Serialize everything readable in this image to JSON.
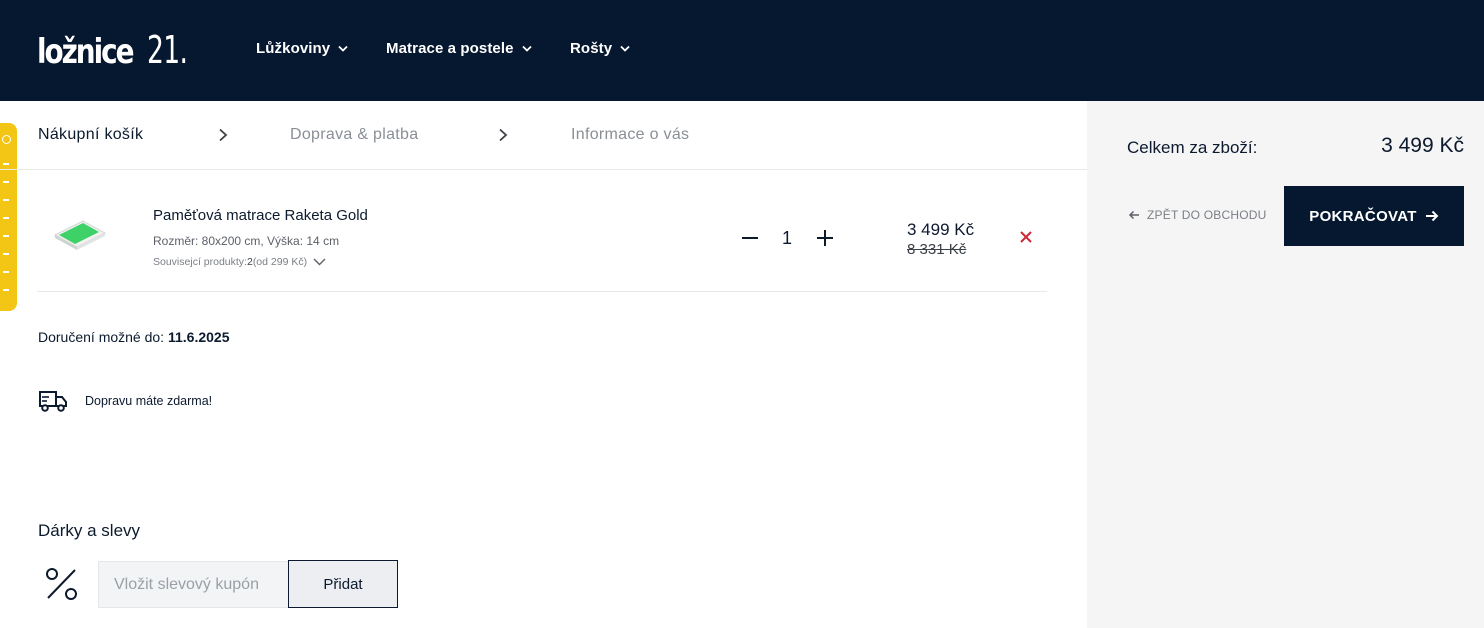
{
  "header": {
    "logo_word": "ložnice",
    "logo_num": "21.",
    "nav": [
      {
        "label": "Lůžkoviny"
      },
      {
        "label": "Matrace a postele"
      },
      {
        "label": "Rošty"
      }
    ]
  },
  "steps": [
    {
      "label": "Nákupní košík"
    },
    {
      "label": "Doprava & platba"
    },
    {
      "label": "Informace o vás"
    }
  ],
  "cart": {
    "item": {
      "name": "Paměťová matrace Raketa Gold",
      "meta": "Rozměr: 80x200 cm, Výška: 14 cm",
      "related_prefix": "Souvisejcí produkty: ",
      "related_count": "2",
      "related_suffix": " (od 299 Kč)",
      "quantity": "1",
      "price": "3 499 Kč",
      "old_price": "8 331 Kč"
    }
  },
  "delivery": {
    "prefix": "Doručení možné do: ",
    "date": "11.6.2025"
  },
  "shipping_note": "Dopravu máte zdarma!",
  "gifts": {
    "title": "Dárky a slevy",
    "coupon_placeholder": "Vložit slevový kupón",
    "add_label": "Přidat"
  },
  "summary": {
    "total_label": "Celkem za zboží:",
    "total_value": "3 499 Kč",
    "back_label": "ZPĚT DO OBCHODU",
    "continue_label": "POKRAČOVAT"
  },
  "colors": {
    "navy": "#061830",
    "accent_yellow": "#f3c515",
    "remove_red": "#d0283a"
  }
}
